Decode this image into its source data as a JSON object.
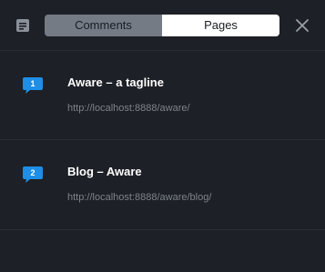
{
  "header": {
    "doc_icon": "document-icon",
    "tabs": [
      {
        "label": "Comments",
        "active": false
      },
      {
        "label": "Pages",
        "active": true
      }
    ],
    "close_icon": "close-icon"
  },
  "pages": [
    {
      "number": "1",
      "title": "Aware – a tagline",
      "url": "http://localhost:8888/aware/"
    },
    {
      "number": "2",
      "title": "Blog – Aware",
      "url": "http://localhost:8888/aware/blog/"
    }
  ],
  "colors": {
    "background": "#1d2026",
    "badge": "#1e8ee6",
    "active_tab": "#ffffff",
    "inactive_tab": "#747b85"
  }
}
